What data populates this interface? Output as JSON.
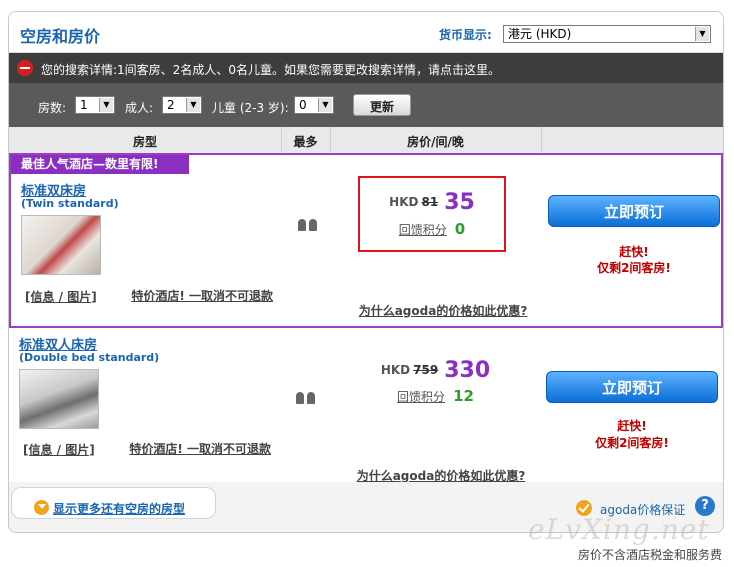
{
  "header": {
    "title": "空房和房价",
    "currency_label": "货币显示:",
    "currency_value": "港元 (HKD)"
  },
  "info_bar": {
    "text": "您的搜索详情:1间客房、2名成人、0名儿童。如果您需要更改搜索详情，请点击这里。"
  },
  "filters": {
    "rooms_label": "房数:",
    "rooms_value": "1",
    "adults_label": "成人:",
    "adults_value": "2",
    "children_label": "儿童 (2-3 岁):",
    "children_value": "0",
    "update_label": "更新"
  },
  "table_headers": {
    "room_type": "房型",
    "max": "最多",
    "price": "房价/间/晚"
  },
  "rooms": [
    {
      "promo": "最佳人气酒店—数里有限!",
      "name": "标准双床房",
      "subname": "(Twin standard)",
      "info_link": "[信息 / 图片]",
      "special_link": "特价酒店! 一取消不可退款",
      "currency": "HKD",
      "old_price": "81",
      "new_price": "35",
      "points_label": "回馈积分",
      "points_value": "0",
      "why_link": "为什么agoda的价格如此优惠?",
      "book_label": "立即预订",
      "hurry_1": "赶快!",
      "hurry_2": "仅剩2间客房!"
    },
    {
      "name": "标准双人床房",
      "subname": "(Double bed standard)",
      "info_link": "[信息 / 图片]",
      "special_link": "特价酒店! 一取消不可退款",
      "currency": "HKD",
      "old_price": "759",
      "new_price": "330",
      "points_label": "回馈积分",
      "points_value": "12",
      "why_link": "为什么agoda的价格如此优惠?",
      "book_label": "立即预订",
      "hurry_1": "赶快!",
      "hurry_2": "仅剩2间客房!"
    }
  ],
  "footer": {
    "more_rooms": "显示更多还有空房的房型",
    "guarantee": "agoda价格保证",
    "help": "?"
  },
  "watermark": "eLvXing.net",
  "tax_note": "房价不含酒店税金和服务费",
  "colors": {
    "brand_blue": "#1a64b0",
    "promo_purple": "#8a2fc0",
    "alert_red": "#c00000",
    "points_green": "#2aa02a"
  }
}
